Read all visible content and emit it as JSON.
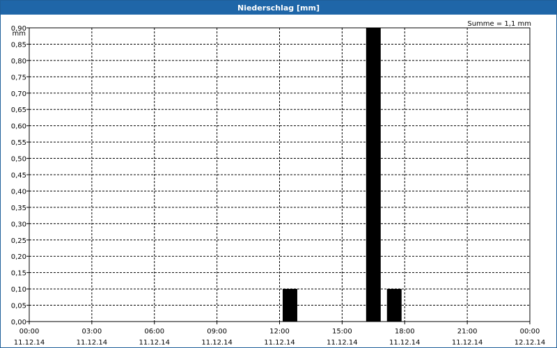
{
  "window": {
    "title": "Niederschlag [mm]"
  },
  "chart_data": {
    "type": "bar",
    "title": "Niederschlag [mm]",
    "ylabel": "mm",
    "sum_label": "Summe = 1,1 mm",
    "ylim": [
      0,
      0.9
    ],
    "grid": true,
    "y_ticks": [
      "0,00",
      "0,05",
      "0,10",
      "0,15",
      "0,20",
      "0,25",
      "0,30",
      "0,35",
      "0,40",
      "0,45",
      "0,50",
      "0,55",
      "0,60",
      "0,65",
      "0,70",
      "0,75",
      "0,80",
      "0,85",
      "0,90"
    ],
    "x_ticks": [
      {
        "time": "00:00",
        "date": "11.12.14"
      },
      {
        "time": "03:00",
        "date": "11.12.14"
      },
      {
        "time": "06:00",
        "date": "11.12.14"
      },
      {
        "time": "09:00",
        "date": "11.12.14"
      },
      {
        "time": "12:00",
        "date": "11.12.14"
      },
      {
        "time": "15:00",
        "date": "11.12.14"
      },
      {
        "time": "18:00",
        "date": "11.12.14"
      },
      {
        "time": "21:00",
        "date": "11.12.14"
      },
      {
        "time": "00:00",
        "date": "12.12.14"
      }
    ],
    "bars": [
      {
        "start": "11.12.14 12:00",
        "end": "11.12.14 13:00",
        "value": 0.1
      },
      {
        "start": "11.12.14 16:00",
        "end": "11.12.14 17:00",
        "value": 0.9
      },
      {
        "start": "11.12.14 17:00",
        "end": "11.12.14 18:00",
        "value": 0.1
      }
    ],
    "bar_color": "#000000",
    "grid_color": "#000000"
  }
}
